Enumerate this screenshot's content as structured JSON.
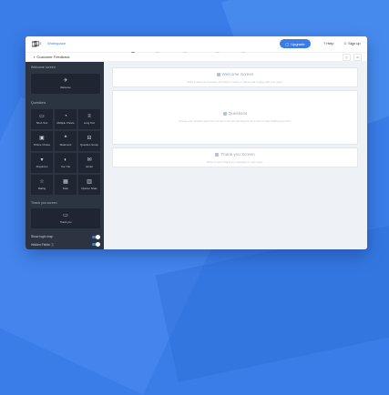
{
  "topbar": {
    "logo_count": "3",
    "workspace": "Workspace",
    "upgrade_label": "Upgrade",
    "help_label": "Help",
    "signup_label": "Sign up"
  },
  "secondbar": {
    "form_name": "Customer Feedback"
  },
  "steps": [
    {
      "label": "Build"
    },
    {
      "label": "Design"
    },
    {
      "label": "Configure"
    },
    {
      "label": "Share"
    },
    {
      "label": "Analyze"
    }
  ],
  "sidebar": {
    "welcome_section": "Welcome screen",
    "welcome_tile": "Welcome",
    "questions_section": "Questions",
    "question_types": [
      {
        "label": "Short Text",
        "icon": "short-text-icon",
        "glyph": "▭"
      },
      {
        "label": "Multiple Choice",
        "icon": "multiple-choice-icon",
        "glyph": "◔"
      },
      {
        "label": "Long Text",
        "icon": "long-text-icon",
        "glyph": "≡"
      },
      {
        "label": "Picture Choice",
        "icon": "picture-choice-icon",
        "glyph": "▣"
      },
      {
        "label": "Statement",
        "icon": "statement-icon",
        "glyph": "❝"
      },
      {
        "label": "Question Group",
        "icon": "question-group-icon",
        "glyph": "⊟"
      },
      {
        "label": "Dropdown",
        "icon": "dropdown-icon",
        "glyph": "▾"
      },
      {
        "label": "Yes / No",
        "icon": "yes-no-icon",
        "glyph": "◐"
      },
      {
        "label": "Email",
        "icon": "email-icon",
        "glyph": "✉"
      },
      {
        "label": "Rating",
        "icon": "rating-icon",
        "glyph": "☆"
      },
      {
        "label": "Date",
        "icon": "date-icon",
        "glyph": "▦"
      },
      {
        "label": "Opinion Scale",
        "icon": "opinion-scale-icon",
        "glyph": "▥"
      }
    ],
    "thankyou_section": "Thank you screen",
    "thankyou_tile": "Thank you",
    "toggles": [
      {
        "label": "Show logic map"
      },
      {
        "label": "Hidden Fields"
      }
    ]
  },
  "canvas": {
    "welcome_title": "Welcome Screen",
    "welcome_sub": "Write a welcome message. Add logos, images or videos and engage with your users.",
    "questions_title": "Questions",
    "questions_sub": "Choose your question type from the list on the left and drag the item here to start building your form.",
    "thankyou_title": "Thank you Screen",
    "thankyou_sub": "Write a custom thank you message for your users."
  },
  "colors": {
    "accent": "#3a7de8",
    "sidebar": "#2c3442",
    "canvas": "#eef2f7"
  }
}
